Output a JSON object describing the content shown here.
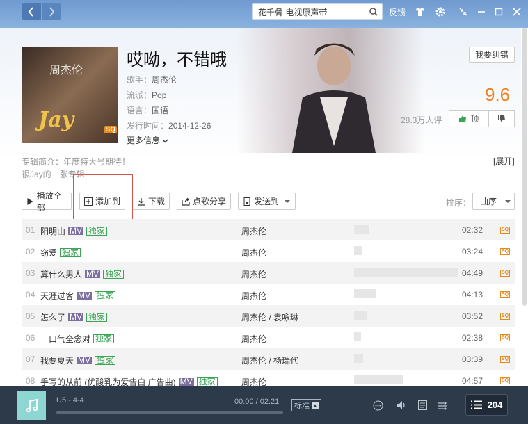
{
  "topbar": {
    "search_value": "花千骨 电视原声带",
    "feedback": "反馈"
  },
  "album": {
    "title": "哎呦，不错哦",
    "singer_label": "歌手：",
    "singer": "周杰伦",
    "genre_label": "流派：",
    "genre": "Pop",
    "lang_label": "语言：",
    "lang": "国语",
    "date_label": "发行时间：",
    "date": "2014-12-26",
    "more": "更多信息",
    "correct_btn": "我要纠错",
    "score": "9.6",
    "rating_count": "28.3万人评",
    "vote_up": "顶",
    "cover_text": "Jay",
    "cover_sub": "周杰伦",
    "cover_sq": "SQ",
    "intro_line1": "专辑简介：年度特大号期待！",
    "intro_line2": "很Jay的一张专辑",
    "expand": "[展开]"
  },
  "toolbar": {
    "play_all": "播放全部",
    "add_to": "添加到",
    "download": "下载",
    "share": "点歌分享",
    "send_to": "发送到",
    "sort_label": "排序：",
    "sort_value": "曲序"
  },
  "songs": [
    {
      "num": "01",
      "title": "阳明山",
      "mv": true,
      "sd": true,
      "artist": "周杰伦",
      "pop": 0.15,
      "duration": "02:32"
    },
    {
      "num": "02",
      "title": "窃爱",
      "mv": false,
      "sd": true,
      "artist": "周杰伦",
      "pop": 0.08,
      "duration": "03:24"
    },
    {
      "num": "03",
      "title": "算什么男人",
      "mv": true,
      "sd": true,
      "artist": "周杰伦",
      "pop": 1.0,
      "duration": "04:49"
    },
    {
      "num": "04",
      "title": "天涯过客",
      "mv": true,
      "sd": true,
      "artist": "周杰伦",
      "pop": 0.21,
      "duration": "04:13"
    },
    {
      "num": "05",
      "title": "怎么了",
      "mv": true,
      "sd": true,
      "artist": "周杰伦 / 袁咏琳",
      "pop": 0.13,
      "duration": "03:52"
    },
    {
      "num": "06",
      "title": "一口气全念对",
      "mv": false,
      "sd": true,
      "artist": "周杰伦",
      "pop": 0.07,
      "duration": "02:38"
    },
    {
      "num": "07",
      "title": "我要夏天",
      "mv": true,
      "sd": true,
      "artist": "周杰伦 / 杨瑞代",
      "pop": 0.09,
      "duration": "03:39"
    },
    {
      "num": "08",
      "title": "手写的从前 (优酸乳为爱告白 广告曲)",
      "mv": true,
      "sd": true,
      "artist": "周杰伦",
      "pop": 0.47,
      "duration": "04:57"
    }
  ],
  "tags": {
    "mv": "MV",
    "sd": "独家",
    "sq": "SQ"
  },
  "player": {
    "now_title": "U5 - 4-4",
    "time_current": "00:00",
    "time_sep": " / ",
    "time_total": "02:21",
    "quality": "标准",
    "playlist_count": "204"
  }
}
